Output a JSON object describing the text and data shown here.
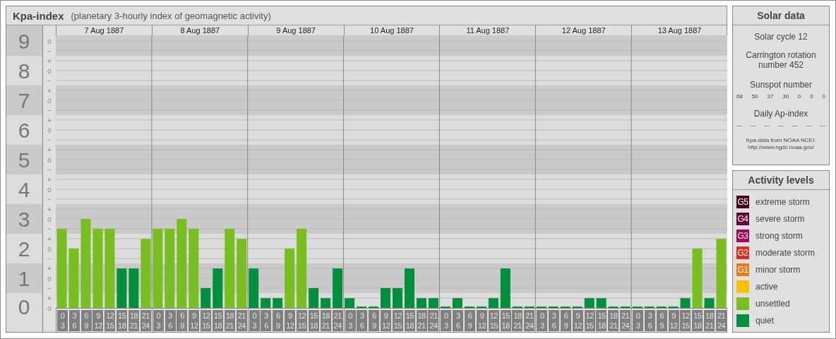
{
  "header": {
    "title": "Kpa-index",
    "subtitle": "(planetary 3-hourly index of geomagnetic activity)"
  },
  "scale": {
    "minor_ticks": [
      "o",
      "−",
      "+",
      "o",
      "−",
      "+",
      "o",
      "−",
      "+",
      "o",
      "−",
      "+",
      "o",
      "−",
      "+",
      "o",
      "−",
      "+",
      "o",
      "−",
      "+",
      "o",
      "−",
      "+",
      "o",
      "−",
      "+",
      "o"
    ]
  },
  "days": [
    "7 Aug 1887",
    "8 Aug 1887",
    "9 Aug 1887",
    "10 Aug 1887",
    "11 Aug 1887",
    "12 Aug 1887",
    "13 Aug 1887"
  ],
  "chart_data": {
    "type": "bar",
    "grid": true,
    "ylim": [
      0,
      9
    ],
    "yticks": [
      {
        "value": 9,
        "label": "9"
      },
      {
        "value": 8,
        "label": "8"
      },
      {
        "value": 7,
        "label": "7"
      },
      {
        "value": 6,
        "label": "6"
      },
      {
        "value": 5,
        "label": "5"
      },
      {
        "value": 4,
        "label": "4"
      },
      {
        "value": 3,
        "label": "3"
      },
      {
        "value": 2,
        "label": "2"
      },
      {
        "value": 1,
        "label": "1"
      },
      {
        "value": 0,
        "label": "0"
      }
    ],
    "categories": [
      "0 3",
      "3 6",
      "6 9",
      "9 12",
      "12 15",
      "15 18",
      "18 21",
      "21 24",
      "0 3",
      "3 6",
      "6 9",
      "9 12",
      "12 15",
      "15 18",
      "18 21",
      "21 24",
      "0 3",
      "3 6",
      "6 9",
      "9 12",
      "12 15",
      "15 18",
      "18 21",
      "21 24",
      "0 3",
      "3 6",
      "6 9",
      "9 12",
      "12 15",
      "15 18",
      "18 21",
      "21 24",
      "0 3",
      "3 6",
      "6 9",
      "9 12",
      "12 15",
      "15 18",
      "18 21",
      "21 24",
      "0 3",
      "3 6",
      "6 9",
      "9 12",
      "12 15",
      "15 18",
      "18 21",
      "21 24",
      "0 3",
      "3 6",
      "6 9",
      "9 12",
      "12 15",
      "15 18",
      "18 21",
      "21 24"
    ],
    "series": [
      {
        "color": "#008f3c",
        "values": [
          null,
          null,
          null,
          null,
          null,
          1.33,
          1.33,
          null,
          null,
          null,
          null,
          null,
          0.67,
          1.33,
          null,
          null,
          1.33,
          0.33,
          0.33,
          null,
          null,
          0.67,
          0.33,
          1.33,
          0.33,
          0,
          0,
          0.67,
          0.67,
          1.33,
          0.33,
          0.33,
          0,
          0.33,
          0,
          0,
          0.33,
          1.33,
          0,
          0,
          0,
          0,
          0,
          0,
          0.33,
          0.33,
          0,
          0,
          0,
          0,
          0,
          0,
          0.33,
          null,
          0.33,
          null
        ]
      },
      {
        "color": "#78be20",
        "values": [
          2.67,
          2,
          3,
          2.67,
          2.67,
          null,
          null,
          2.33,
          2.67,
          2.67,
          3,
          2.67,
          null,
          null,
          2.67,
          2.33,
          null,
          null,
          null,
          2,
          2.67,
          null,
          null,
          null,
          null,
          null,
          null,
          null,
          null,
          null,
          null,
          null,
          null,
          null,
          null,
          null,
          null,
          null,
          null,
          null,
          null,
          null,
          null,
          null,
          null,
          null,
          null,
          null,
          null,
          null,
          null,
          null,
          null,
          2,
          null,
          2.33
        ]
      }
    ]
  },
  "solar": {
    "title": "Solar data",
    "cycle": "Solar cycle 12",
    "rotation": "Carrington rotation number 452",
    "sunspot_title": "Sunspot number",
    "sunspots": [
      "68",
      "50",
      "37",
      "30",
      "0",
      "0",
      "0"
    ],
    "ap_title": "Daily Ap-index",
    "ap_values": [
      "—",
      "—",
      "—",
      "—",
      "—",
      "—",
      "—"
    ],
    "source": "Kpa-data from NOAA NCEI:",
    "source_url": "http://www.ngdc.noaa.gov/"
  },
  "legend": {
    "title": "Activity levels",
    "items": [
      {
        "badge": "G5",
        "label": "extreme storm",
        "color": "#42001f"
      },
      {
        "badge": "G4",
        "label": "severe storm",
        "color": "#6a0036"
      },
      {
        "badge": "G3",
        "label": "strong storm",
        "color": "#a6005c"
      },
      {
        "badge": "G2",
        "label": "moderate storm",
        "color": "#d8301e"
      },
      {
        "badge": "G1",
        "label": "minor storm",
        "color": "#e87a1c"
      },
      {
        "label": "active",
        "color": "#f8c200"
      },
      {
        "label": "unsettled",
        "color": "#78be20"
      },
      {
        "label": "quiet",
        "color": "#008f3c"
      }
    ]
  }
}
